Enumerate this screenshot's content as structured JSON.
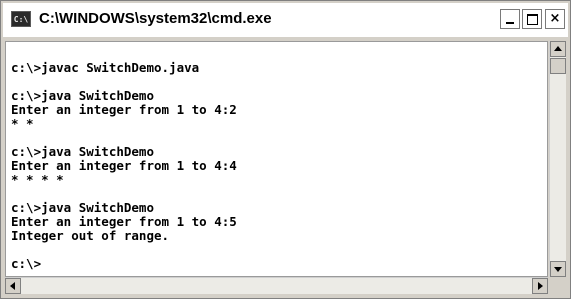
{
  "window": {
    "title": "C:\\WINDOWS\\system32\\cmd.exe",
    "icon_name": "cmd-icon",
    "icon_text": "C:\\"
  },
  "controls": {
    "minimize": "minimize-icon",
    "maximize": "maximize-icon",
    "close": "close-icon",
    "close_glyph": "×"
  },
  "console": {
    "lines": [
      "c:\\>javac SwitchDemo.java",
      "",
      "c:\\>java SwitchDemo",
      "Enter an integer from 1 to 4:2",
      "* *",
      "",
      "c:\\>java SwitchDemo",
      "Enter an integer from 1 to 4:4",
      "* * * *",
      "",
      "c:\\>java SwitchDemo",
      "Enter an integer from 1 to 4:5",
      "Integer out of range.",
      "",
      "c:\\>"
    ]
  }
}
